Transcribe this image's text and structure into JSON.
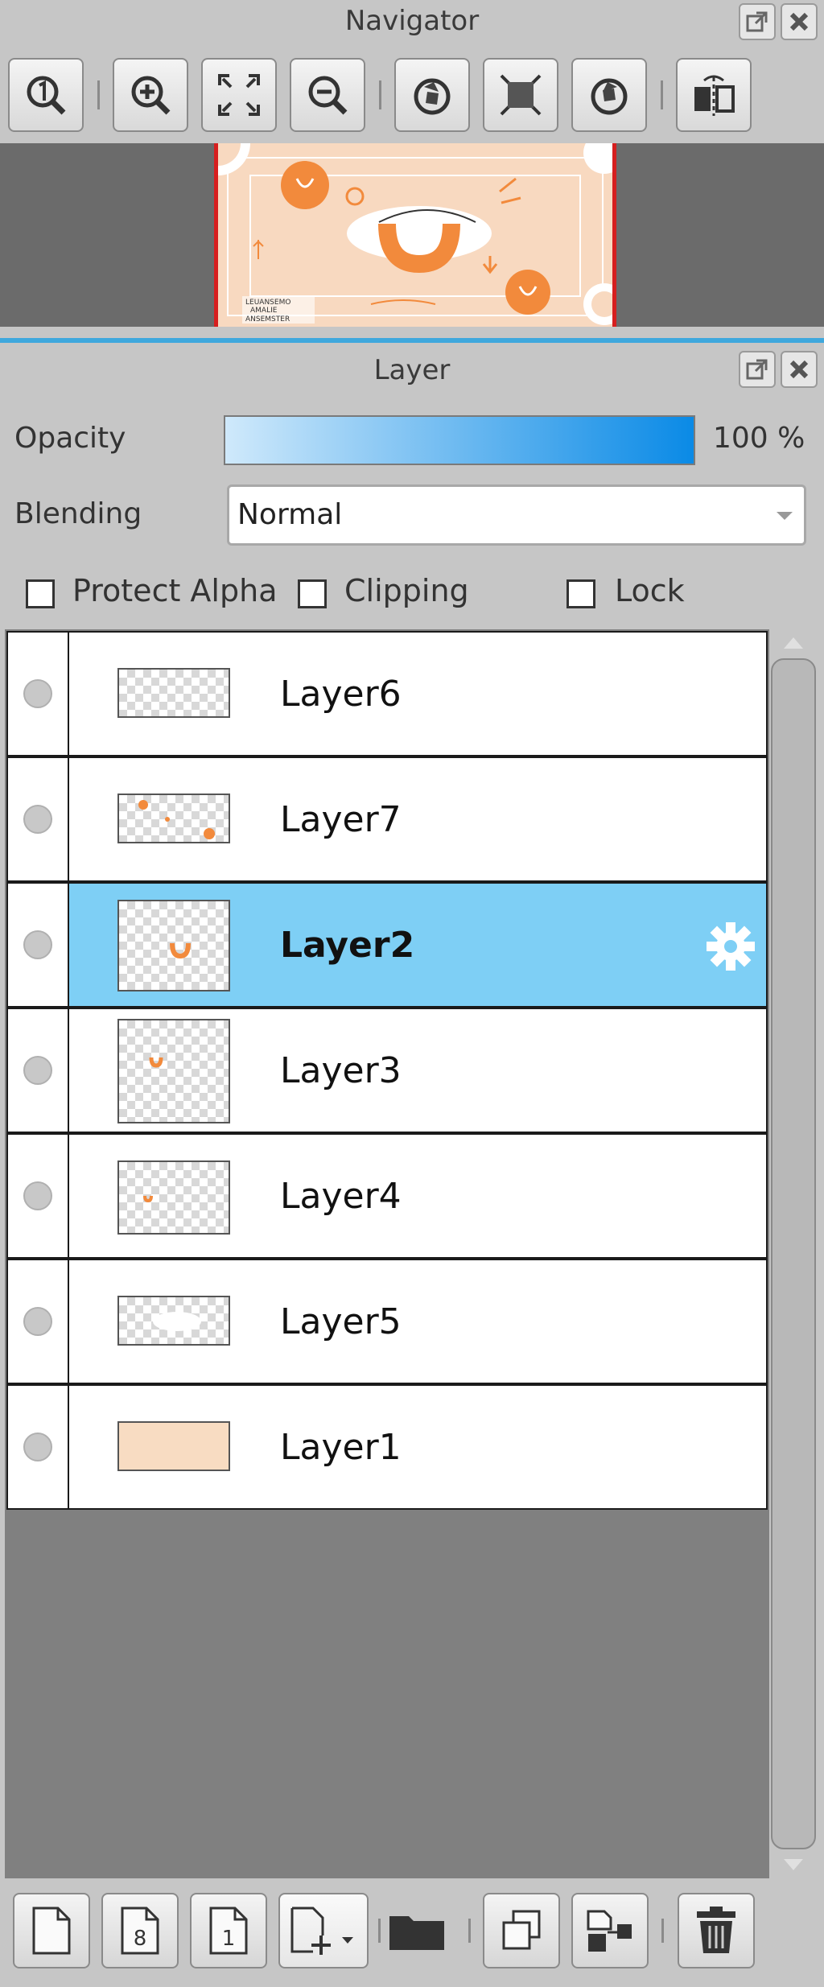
{
  "navigator": {
    "title": "Navigator",
    "tools": [
      {
        "icon": "zoom-actual-icon"
      },
      {
        "icon": "zoom-in-icon"
      },
      {
        "icon": "fit-screen-icon"
      },
      {
        "icon": "zoom-out-icon"
      },
      {
        "icon": "rotate-left-icon"
      },
      {
        "icon": "reset-view-icon"
      },
      {
        "icon": "rotate-right-icon"
      },
      {
        "icon": "flip-horizontal-icon"
      }
    ],
    "preview_labels": [
      "LEUANSEMO",
      "AMALIE",
      "ANSEMSTER"
    ]
  },
  "layer_panel": {
    "title": "Layer",
    "opacity_label": "Opacity",
    "opacity_value": "100 %",
    "opacity_fraction": 1.0,
    "blending_label": "Blending",
    "blending_value": "Normal",
    "checkboxes": {
      "protect_alpha": {
        "label": "Protect Alpha",
        "checked": false
      },
      "clipping": {
        "label": "Clipping",
        "checked": false
      },
      "lock": {
        "label": "Lock",
        "checked": false
      }
    },
    "layers": [
      {
        "name": "Layer6",
        "selected": false
      },
      {
        "name": "Layer7",
        "selected": false
      },
      {
        "name": "Layer2",
        "selected": true
      },
      {
        "name": "Layer3",
        "selected": false
      },
      {
        "name": "Layer4",
        "selected": false
      },
      {
        "name": "Layer5",
        "selected": false
      },
      {
        "name": "Layer1",
        "selected": false
      }
    ],
    "bottom_tools": [
      {
        "icon": "new-layer-icon"
      },
      {
        "icon": "new-8bit-layer-icon",
        "text": "8"
      },
      {
        "icon": "new-1bit-layer-icon",
        "text": "1"
      },
      {
        "icon": "add-layer-menu-icon"
      },
      {
        "icon": "new-folder-icon"
      },
      {
        "icon": "duplicate-layer-icon"
      },
      {
        "icon": "merge-down-icon"
      },
      {
        "icon": "delete-layer-icon"
      }
    ]
  },
  "colors": {
    "accent_selected": "#7ecff5",
    "opacity_bar_start": "#cfe9fb",
    "opacity_bar_end": "#0a8ae6",
    "preview_bg": "#f8d9c0",
    "preview_accent": "#f28a3c"
  }
}
